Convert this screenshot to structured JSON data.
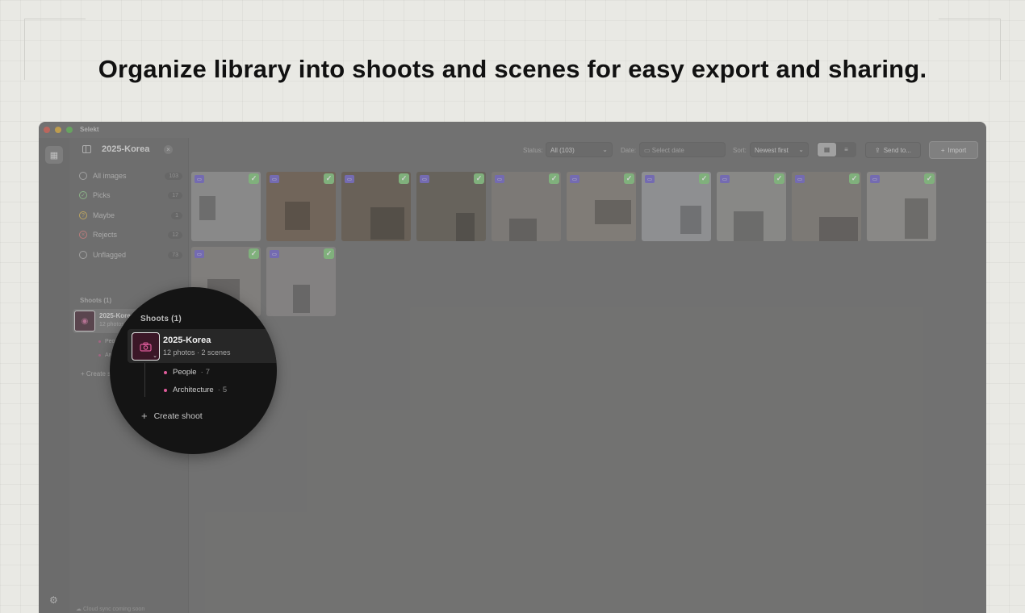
{
  "headline": "Organize library into shoots and scenes for easy export and sharing.",
  "app": {
    "name": "Selekt",
    "title": "2025-Korea",
    "traffic_lights": [
      "#e06b5f",
      "#e3b64a",
      "#6cc063"
    ]
  },
  "sidebar": {
    "filters": [
      {
        "label": "All images",
        "count": "103",
        "icon": "circle-outline-icon"
      },
      {
        "label": "Picks",
        "count": "17",
        "icon": "check-circle-icon"
      },
      {
        "label": "Maybe",
        "count": "1",
        "icon": "question-circle-icon"
      },
      {
        "label": "Rejects",
        "count": "12",
        "icon": "x-circle-icon"
      },
      {
        "label": "Unflagged",
        "count": "73",
        "icon": "circle-outline-icon"
      }
    ],
    "shoots_heading": "Shoots (1)",
    "shoot": {
      "name": "2025-Korea",
      "subtitle": "12 photos · 2 scenes"
    },
    "scenes": [
      {
        "label": "People",
        "count": "7"
      },
      {
        "label": "Architecture",
        "count": "5"
      }
    ],
    "create_label": "Create shoot",
    "cloud_note": "Cloud sync coming soon"
  },
  "toolbar": {
    "status_label": "Status:",
    "status_value": "All (103)",
    "date_label": "Date:",
    "date_placeholder": "Select date",
    "sort_label": "Sort:",
    "sort_value": "Newest first",
    "send_label": "Send to...",
    "import_label": "Import"
  },
  "photos": [
    {
      "tone": "#9c9c9c"
    },
    {
      "tone": "#7b6a5a"
    },
    {
      "tone": "#6f6558"
    },
    {
      "tone": "#6d675e"
    },
    {
      "tone": "#8a8682"
    },
    {
      "tone": "#8f8a83"
    },
    {
      "tone": "#a2a4a7"
    },
    {
      "tone": "#9a9a98"
    },
    {
      "tone": "#8a8580"
    },
    {
      "tone": "#9c9a97"
    },
    {
      "tone": "#8f8d8a"
    },
    {
      "tone": "#939190"
    }
  ],
  "colors": {
    "accent_purple": "#7e72d3",
    "pick_green": "#8fd28a",
    "scene_pink": "#e05c9b"
  }
}
